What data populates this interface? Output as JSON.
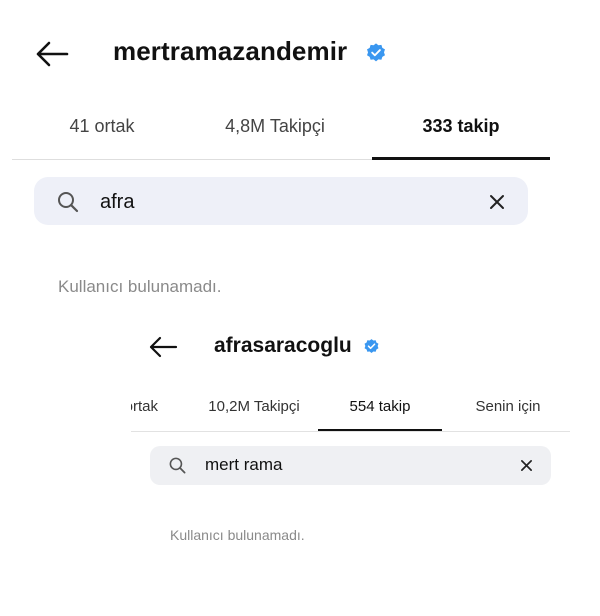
{
  "top": {
    "username": "mertramazandemir",
    "tabs": [
      {
        "label": "41 ortak"
      },
      {
        "label": "4,8M Takipçi"
      },
      {
        "label": "333 takip"
      }
    ],
    "active_tab": "333 takip",
    "search": {
      "value": "afra"
    },
    "empty_message": "Kullanıcı bulunamadı."
  },
  "bottom": {
    "username": "afrasaracoglu",
    "tabs": [
      {
        "label": "ortak"
      },
      {
        "label": "10,2M Takipçi"
      },
      {
        "label": "554 takip"
      },
      {
        "label": "Senin için"
      }
    ],
    "active_tab": "554 takip",
    "search": {
      "value": "mert rama"
    },
    "empty_message": "Kullanıcı bulunamadı."
  },
  "icons": {
    "back": "arrow-left-icon",
    "verified": "verified-badge-icon",
    "search": "search-icon",
    "clear": "close-icon"
  },
  "colors": {
    "verified_blue": "#3a97f0",
    "search_bg": "#eef0f8",
    "muted_text": "#8a8a8a",
    "underline": "#111111"
  }
}
